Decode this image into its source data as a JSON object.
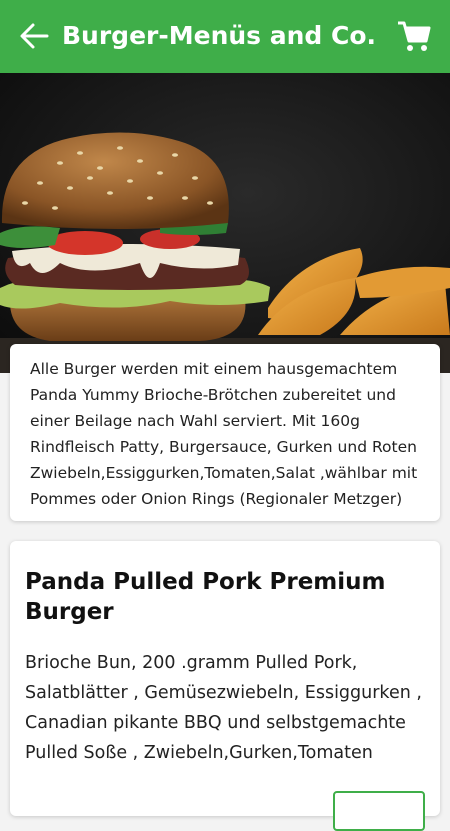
{
  "appbar": {
    "title": "Burger-Menüs and Co.",
    "back_icon": "arrow-left-icon",
    "cart_icon": "shopping-cart-icon",
    "color": "#3fae49"
  },
  "hero": {
    "image": "burger-with-potato-wedges-photo"
  },
  "category": {
    "description": "Alle Burger werden mit einem hausgemachtem Panda Yummy Brioche-Brötchen zubereitet und einer Beilage nach Wahl serviert. Mit 160g Rindfleisch Patty, Burgersauce, Gurken und Roten Zwiebeln,Essiggurken,Tomaten,Salat ,wählbar mit Pommes oder Onion Rings (Regionaler Metzger)"
  },
  "products": [
    {
      "name": "Panda Pulled Pork Premium Burger",
      "description": "Brioche Bun, 200 .gramm Pulled Pork, Salatblätter , Gemüsezwiebeln, Essiggurken , Canadian pikante BBQ und selbstgemachte Pulled Soße , Zwiebeln,Gurken,Tomaten"
    }
  ]
}
